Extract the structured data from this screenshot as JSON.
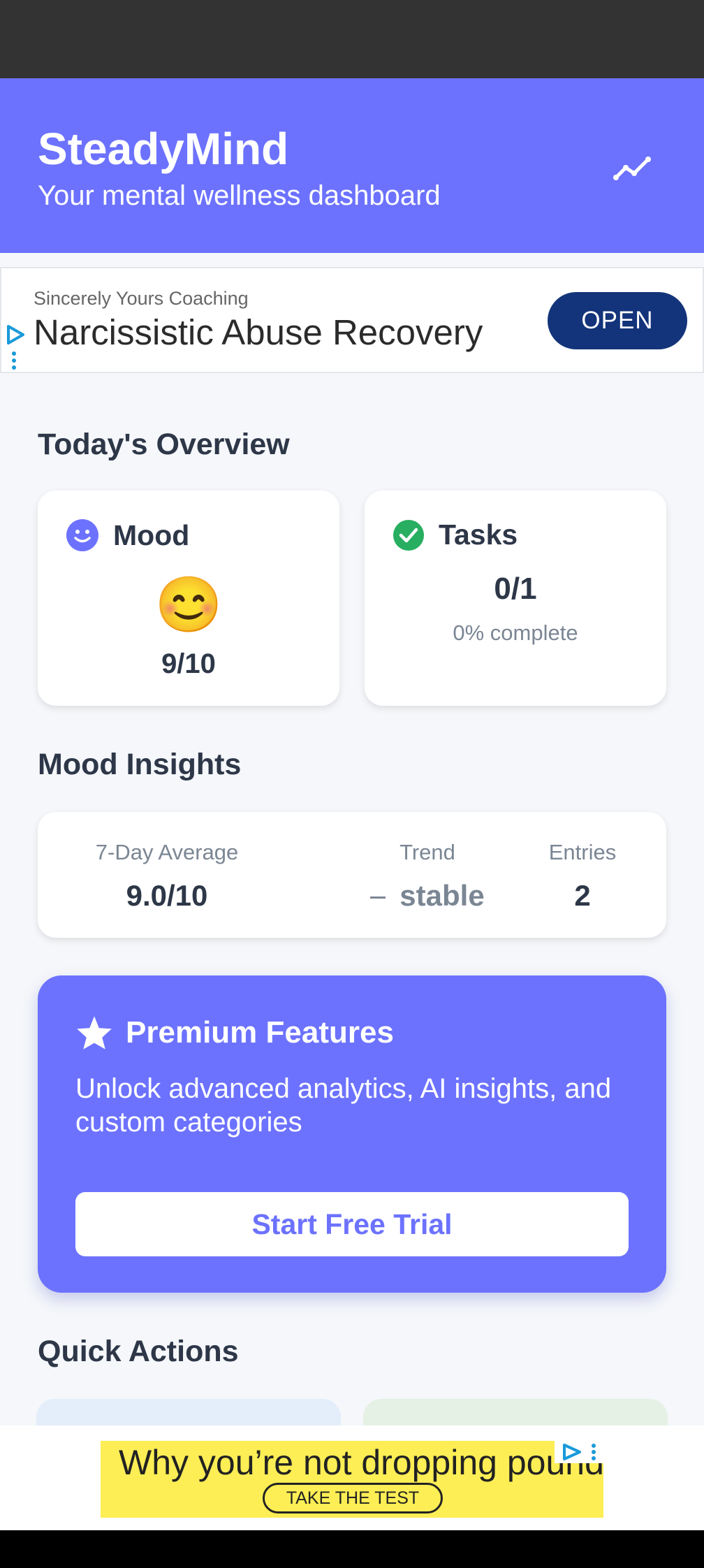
{
  "header": {
    "title": "SteadyMind",
    "subtitle": "Your mental wellness dashboard"
  },
  "ad_top": {
    "sponsor": "Sincerely Yours Coaching",
    "headline": "Narcissistic Abuse Recovery",
    "cta": "OPEN"
  },
  "overview": {
    "title": "Today's Overview",
    "mood": {
      "label": "Mood",
      "emoji": "😊",
      "value": "9/10"
    },
    "tasks": {
      "label": "Tasks",
      "value": "0/1",
      "sub": "0% complete"
    }
  },
  "insights": {
    "title": "Mood Insights",
    "average": {
      "label": "7-Day Average",
      "value": "9.0/10"
    },
    "trend": {
      "label": "Trend",
      "value": "stable"
    },
    "entries": {
      "label": "Entries",
      "value": "2"
    }
  },
  "premium": {
    "title": "Premium Features",
    "description": "Unlock advanced analytics, AI insights, and custom categories",
    "cta": "Start Free Trial"
  },
  "quick_actions": {
    "title": "Quick Actions"
  },
  "ad_bottom": {
    "text": "Why you’re not dropping pounds",
    "cta": "TAKE THE TEST"
  },
  "colors": {
    "primary": "#6c72fe",
    "success": "#27ae60",
    "ad_button": "#13347a",
    "ad_yellow": "#fdee55"
  }
}
